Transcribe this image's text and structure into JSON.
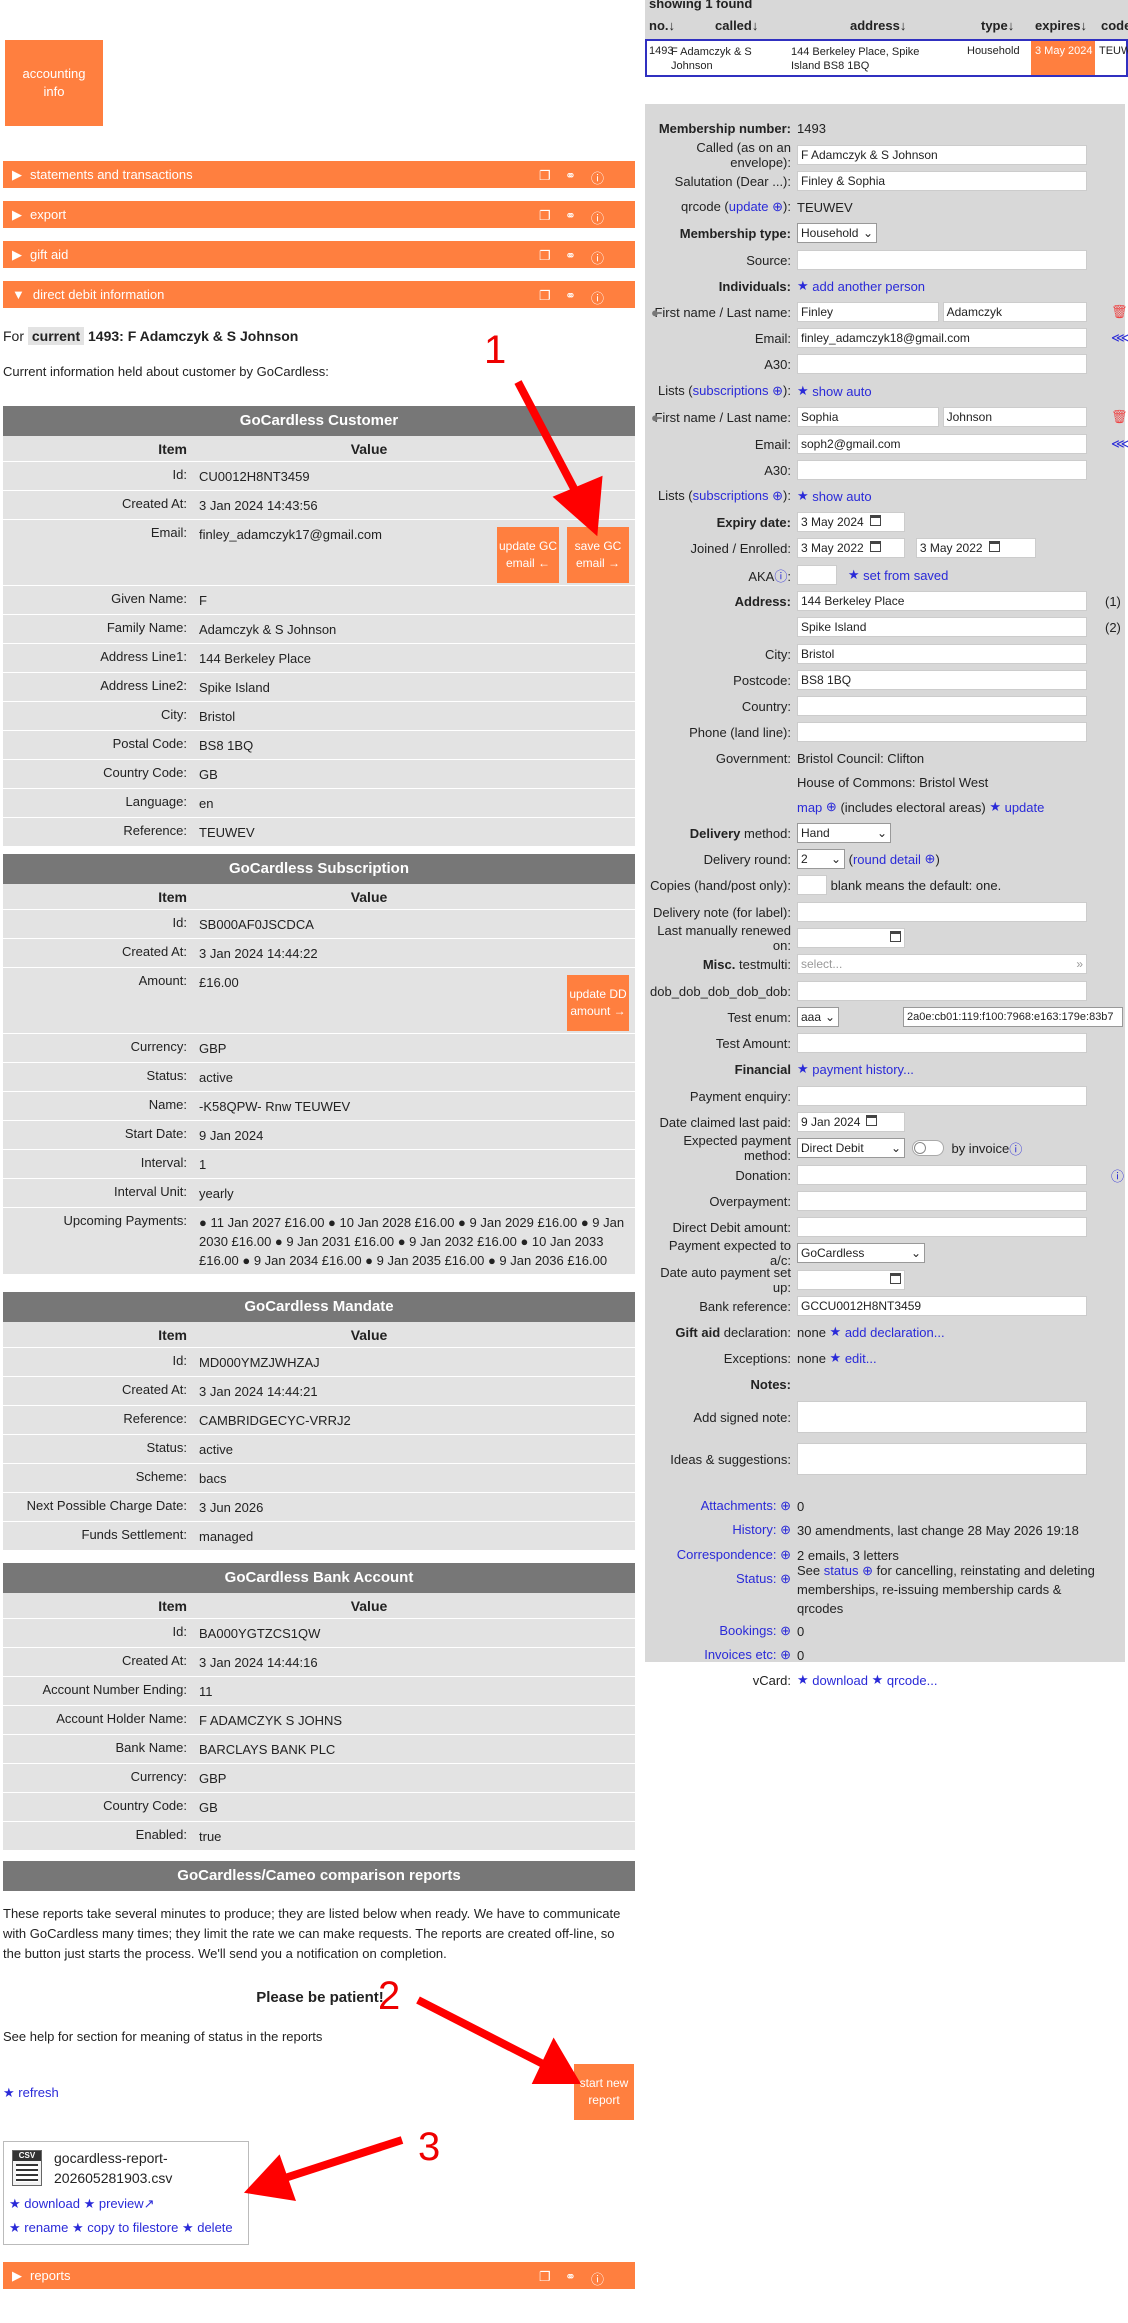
{
  "accounting_btn": "accounting info",
  "sections": [
    {
      "label": "statements and transactions"
    },
    {
      "label": "export"
    },
    {
      "label": "gift aid"
    },
    {
      "label": "direct debit information"
    }
  ],
  "dd": {
    "for_prefix": "For",
    "current_badge": "current",
    "member": "1493: F Adamczyk & S Johnson",
    "info_line": "Current information held about customer by GoCardless:"
  },
  "col_item": "Item",
  "col_value": "Value",
  "customer": {
    "title": "GoCardless Customer",
    "rows": [
      [
        "Id:",
        "CU0012H8NT3459"
      ],
      [
        "Created At:",
        "3 Jan 2024 14:43:56"
      ],
      [
        "Email:",
        "finley_adamczyk17@gmail.com"
      ],
      [
        "Given Name:",
        "F"
      ],
      [
        "Family Name:",
        "Adamczyk & S Johnson"
      ],
      [
        "Address Line1:",
        "144 Berkeley Place"
      ],
      [
        "Address Line2:",
        "Spike Island"
      ],
      [
        "City:",
        "Bristol"
      ],
      [
        "Postal Code:",
        "BS8 1BQ"
      ],
      [
        "Country Code:",
        "GB"
      ],
      [
        "Language:",
        "en"
      ],
      [
        "Reference:",
        "TEUWEV"
      ]
    ],
    "btn_update": "update GC email ←",
    "btn_save": "save GC email →"
  },
  "subscription": {
    "title": "GoCardless Subscription",
    "rows": [
      [
        "Id:",
        "SB000AF0JSCDCA"
      ],
      [
        "Created At:",
        "3 Jan 2024 14:44:22"
      ],
      [
        "Amount:",
        "£16.00"
      ],
      [
        "Currency:",
        "GBP"
      ],
      [
        "Status:",
        "active"
      ],
      [
        "Name:",
        "-K58QPW- Rnw TEUWEV"
      ],
      [
        "Start Date:",
        "9 Jan 2024"
      ],
      [
        "Interval:",
        "1"
      ],
      [
        "Interval Unit:",
        "yearly"
      ],
      [
        "Upcoming Payments:",
        "● 11 Jan 2027 £16.00 ● 10 Jan 2028 £16.00 ● 9 Jan 2029 £16.00 ● 9 Jan 2030 £16.00 ● 9 Jan 2031 £16.00 ● 9 Jan 2032 £16.00 ● 10 Jan 2033 £16.00 ● 9 Jan 2034 £16.00 ● 9 Jan 2035 £16.00 ● 9 Jan 2036 £16.00"
      ]
    ],
    "btn_update": "update DD amount →"
  },
  "mandate": {
    "title": "GoCardless Mandate",
    "rows": [
      [
        "Id:",
        "MD000YMZJWHZAJ"
      ],
      [
        "Created At:",
        "3 Jan 2024 14:44:21"
      ],
      [
        "Reference:",
        "CAMBRIDGECYC-VRRJ2"
      ],
      [
        "Status:",
        "active"
      ],
      [
        "Scheme:",
        "bacs"
      ],
      [
        "Next Possible Charge Date:",
        "3 Jun 2026"
      ],
      [
        "Funds Settlement:",
        "managed"
      ]
    ]
  },
  "bank": {
    "title": "GoCardless Bank Account",
    "rows": [
      [
        "Id:",
        "BA000YGTZCS1QW"
      ],
      [
        "Created At:",
        "3 Jan 2024 14:44:16"
      ],
      [
        "Account Number Ending:",
        "11"
      ],
      [
        "Account Holder Name:",
        "F ADAMCZYK S JOHNS"
      ],
      [
        "Bank Name:",
        "BARCLAYS BANK PLC"
      ],
      [
        "Currency:",
        "GBP"
      ],
      [
        "Country Code:",
        "GB"
      ],
      [
        "Enabled:",
        "true"
      ]
    ]
  },
  "reports": {
    "title": "GoCardless/Cameo comparison reports",
    "desc": "These reports take several minutes to produce; they are listed below when ready. We have to communicate with GoCardless many times; they limit the rate we can make requests. The reports are created off-line, so the button just starts the process. We'll send you a notification on completion.",
    "patient": "Please be patient!",
    "help": "See help for section for meaning of status in the reports",
    "refresh": "refresh",
    "start_btn": "start new report",
    "file_name": "gocardless-report-202605281903.csv",
    "file_badge": "CSV",
    "download": "download",
    "preview": "preview",
    "rename": "rename",
    "copy": "copy to filestore",
    "delete": "delete"
  },
  "bottom_section": "reports",
  "annot": [
    "1",
    "2",
    "3"
  ],
  "results": {
    "showing": "showing 1 found",
    "headers": [
      "no.↓",
      "called↓",
      "address↓",
      "type↓",
      "expires↓",
      "code"
    ],
    "row": [
      "1493",
      "F Adamczyk & S Johnson",
      "144 Berkeley Place, Spike Island BS8 1BQ",
      "Household",
      "3 May 2024",
      "TEUWE"
    ]
  },
  "form": {
    "membership_number_lbl": "Membership number:",
    "membership_number": "1493",
    "called_lbl": "Called (as on an envelope):",
    "called": "F Adamczyk & S Johnson",
    "salutation_lbl": "Salutation (Dear ...):",
    "salutation": "Finley & Sophia",
    "qrcode_lbl_a": "qrcode (",
    "qrcode_lbl_link": "update",
    "qrcode_lbl_b": "):",
    "qrcode": "TEUWEV",
    "type_lbl": "Membership type:",
    "type": "Household",
    "source_lbl": "Source:",
    "individuals_lbl": "Individuals:",
    "add_person": "add another person",
    "name_lbl": "First name / Last name:",
    "email_lbl": "Email:",
    "a30_lbl": "A30:",
    "lists_lbl_a": "Lists (",
    "lists_lbl_link": "subscriptions",
    "lists_lbl_b": "):",
    "show_auto": "show auto",
    "p1_first": "Finley",
    "p1_last": "Adamczyk",
    "p1_email": "finley_adamczyk18@gmail.com",
    "p2_first": "Sophia",
    "p2_last": "Johnson",
    "p2_email": "soph2@gmail.com",
    "expiry_lbl": "Expiry date:",
    "expiry": "3 May 2024",
    "joined_lbl": "Joined / Enrolled:",
    "joined": "3 May 2022",
    "enrolled": "3 May 2022",
    "aka_lbl": "AKA",
    "set_saved": "set from saved",
    "address_lbl": "Address:",
    "addr1": "144 Berkeley Place",
    "addr2": "Spike Island",
    "addr1_n": "(1)",
    "addr2_n": "(2)",
    "city_lbl": "City:",
    "city": "Bristol",
    "postcode_lbl": "Postcode:",
    "postcode": "BS8 1BQ",
    "country_lbl": "Country:",
    "phone_lbl": "Phone (land line):",
    "gov_lbl": "Government:",
    "gov1": "Bristol Council: Clifton",
    "gov2": "House of Commons: Bristol West",
    "map": "map",
    "map_note": "(includes electoral areas)",
    "update": "update",
    "delivery_lbl_b": "Delivery",
    "delivery_lbl": "method:",
    "delivery": "Hand",
    "round_lbl": "Delivery round:",
    "round": "2",
    "round_detail": "round detail",
    "copies_lbl": "Copies (hand/post only):",
    "copies_note": "blank means the default: one.",
    "note_lbl": "Delivery note (for label):",
    "renewed_lbl": "Last manually renewed on:",
    "misc_lbl_b": "Misc.",
    "misc_lbl": "testmulti:",
    "misc_ph": "select...",
    "dob_lbl": "dob_dob_dob_dob_dob:",
    "enum_lbl": "Test enum:",
    "enum": "aaa",
    "ip": "2a0e:cb01:119:f100:7968:e163:179e:83b7",
    "amount_lbl": "Test Amount:",
    "financial_lbl": "Financial",
    "payment_history": "payment history...",
    "enquiry_lbl": "Payment enquiry:",
    "claimed_lbl": "Date claimed last paid:",
    "claimed": "9 Jan 2024",
    "expected_lbl": "Expected payment method:",
    "expected": "Direct Debit",
    "by_invoice": "by invoice",
    "donation_lbl": "Donation:",
    "overpay_lbl": "Overpayment:",
    "ddamt_lbl": "Direct Debit amount:",
    "expected_ac_lbl": "Payment expected to a/c:",
    "expected_ac": "GoCardless",
    "auto_lbl": "Date auto payment set up:",
    "bankref_lbl": "Bank reference:",
    "bankref": "GCCU0012H8NT3459",
    "giftaid_lbl_b": "Gift aid",
    "giftaid_lbl": "declaration:",
    "giftaid_none": "none",
    "add_decl": "add declaration...",
    "exceptions_lbl": "Exceptions:",
    "exc_none": "none",
    "edit": "edit...",
    "notes_lbl": "Notes:",
    "signed_lbl": "Add signed note:",
    "ideas_lbl": "Ideas & suggestions:",
    "attach_lbl": "Attachments:",
    "attach": "0",
    "history_lbl": "History:",
    "history": "30 amendments, last change 28 May 2026 19:18",
    "corr_lbl": "Correspondence:",
    "corr": "2 emails, 3 letters",
    "status_lbl": "Status:",
    "status_see": "See",
    "status_link": "status",
    "status_rest": "for cancelling, reinstating and deleting memberships, re-issuing membership cards & qrcodes",
    "bookings_lbl": "Bookings:",
    "bookings": "0",
    "invoices_lbl": "Invoices etc:",
    "invoices": "0",
    "vcard_lbl": "vCard:",
    "vdownload": "download",
    "vqr": "qrcode..."
  },
  "colors": {
    "accent": "#ff7f3f",
    "header_gray": "#777777",
    "panel_gray": "#d8d8d8",
    "link": "#2a2ad8",
    "annotation": "#ff0000"
  }
}
